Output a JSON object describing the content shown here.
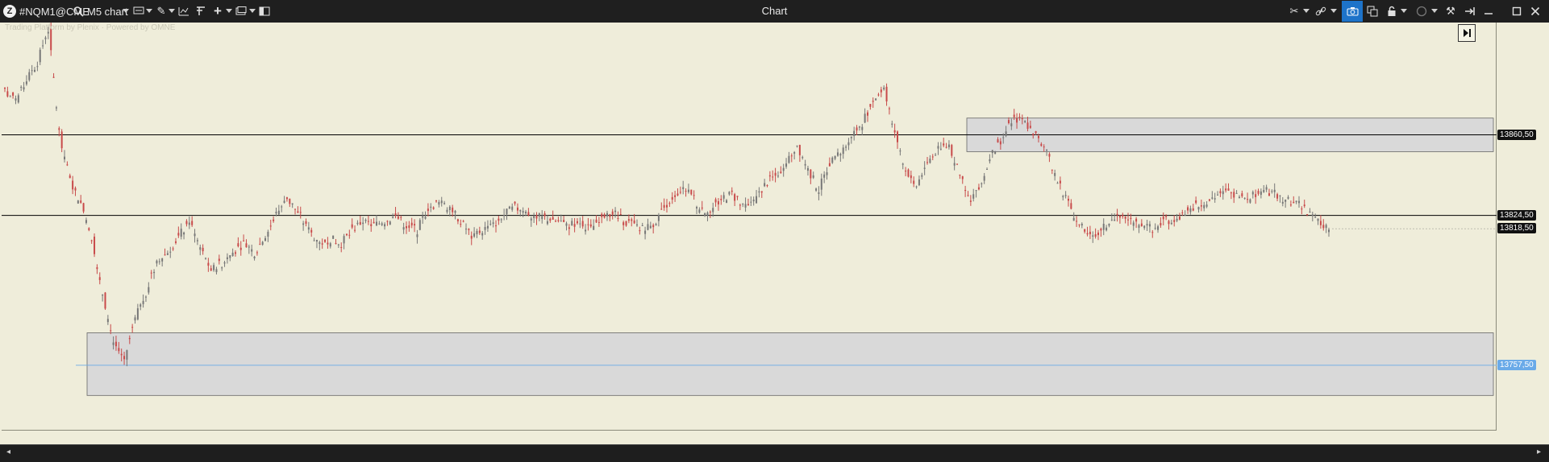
{
  "window": {
    "title": "Chart",
    "symbol": "#NQM1@CME",
    "timeframe": "M5 chart",
    "active_tool_color": "#1d73c9"
  },
  "toolbar": {
    "left_icons": [
      "app-logo-icon",
      "search-icon",
      "chevron-down-icon",
      "chart-type-icon",
      "chevron-down-icon",
      "pencil-icon",
      "chevron-down-icon",
      "indicators-icon",
      "template-icon",
      "crosshair-plus-icon",
      "chevron-down-icon",
      "layout-icon",
      "chevron-down-icon",
      "panel-icon"
    ],
    "right_icons": [
      "magnet-icon",
      "chevron-down-icon",
      "link-icon",
      "chevron-down-icon",
      "camera-icon",
      "clone-icon",
      "lock-icon",
      "chevron-down-icon",
      "circle-icon",
      "chevron-down-icon",
      "tools-icon",
      "pin-icon",
      "minimize-icon",
      "maximize-icon",
      "close-icon"
    ]
  },
  "watermark": "Trading Platform by Plenix · Powered by OMNE",
  "chart_data": {
    "type": "candlestick",
    "instrument": "#NQM1@CME",
    "timeframe": "M5",
    "price_levels": [
      {
        "price": 13860.5,
        "label": "13860,50",
        "style": "horizontal-line",
        "color": "#000000"
      },
      {
        "price": 13824.5,
        "label": "13824,50",
        "style": "horizontal-line",
        "color": "#000000"
      },
      {
        "price": 13818.5,
        "label": "13818,50",
        "style": "last-price",
        "color": "#000000"
      },
      {
        "price": 13757.5,
        "label": "13757,50",
        "style": "horizontal-line",
        "color": "#6aaae8"
      }
    ],
    "zones": [
      {
        "from": 13853,
        "to": 13868,
        "fill": "#d9d9d9"
      },
      {
        "from": 13744,
        "to": 13772,
        "fill": "#d9d9d9"
      }
    ],
    "y_range": [
      13729,
      13910
    ],
    "colors": {
      "up": "#777777",
      "down": "#c84a4a",
      "background": "#efedda"
    },
    "closes": [
      13880,
      13875,
      13885,
      13893,
      13908,
      13862,
      13840,
      13830,
      13815,
      13790,
      13768,
      13760,
      13778,
      13790,
      13804,
      13808,
      13815,
      13822,
      13810,
      13800,
      13803,
      13808,
      13812,
      13808,
      13815,
      13825,
      13832,
      13826,
      13818,
      13812,
      13814,
      13812,
      13818,
      13822,
      13820,
      13822,
      13824,
      13820,
      13818,
      13828,
      13830,
      13828,
      13822,
      13815,
      13818,
      13820,
      13825,
      13828,
      13826,
      13824,
      13823,
      13822,
      13820,
      13822,
      13818,
      13825,
      13826,
      13822,
      13820,
      13818,
      13822,
      13830,
      13835,
      13836,
      13828,
      13826,
      13832,
      13834,
      13828,
      13830,
      13838,
      13842,
      13848,
      13856,
      13845,
      13836,
      13848,
      13852,
      13860,
      13866,
      13876,
      13882,
      13862,
      13845,
      13838,
      13848,
      13854,
      13856,
      13842,
      13832,
      13840,
      13852,
      13860,
      13868,
      13866,
      13860,
      13852,
      13840,
      13830,
      13820,
      13815,
      13818,
      13822,
      13824,
      13823,
      13820,
      13818,
      13822,
      13824,
      13826,
      13829,
      13832,
      13834,
      13835,
      13832,
      13834,
      13836,
      13834,
      13832,
      13830,
      13826,
      13822,
      13818
    ]
  },
  "scroll": {
    "left": "◂",
    "right": "▸"
  }
}
